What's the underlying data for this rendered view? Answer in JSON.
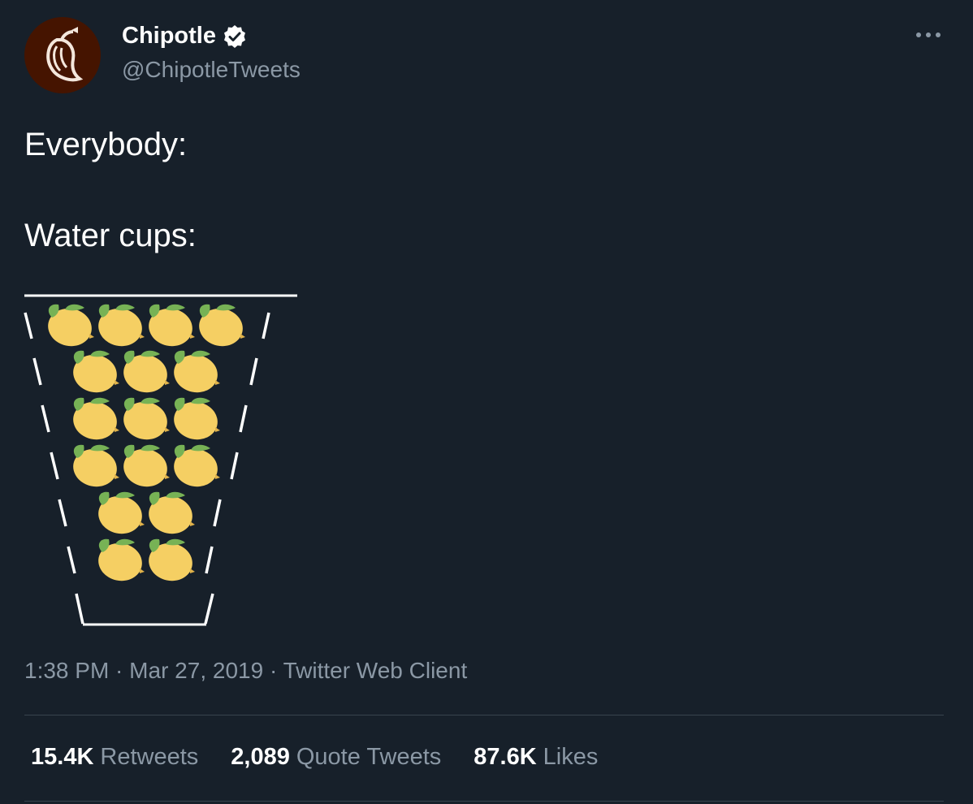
{
  "tweet": {
    "author": {
      "display_name": "Chipotle",
      "handle": "@ChipotleTweets",
      "avatar_icon": "chipotle-pepper-logo",
      "verified": true
    },
    "lines": [
      "Everybody:",
      "Water cups:"
    ],
    "art": {
      "description_icon": "lemon-emoji",
      "rows_lemon_counts": [
        4,
        3,
        3,
        3,
        2,
        2
      ],
      "colors": {
        "lemon": "#f5cf63",
        "leaf": "#77b255"
      }
    },
    "meta": {
      "time": "1:38 PM",
      "date": "Mar 27, 2019",
      "client": "Twitter Web Client",
      "separator": " · "
    },
    "stats": [
      {
        "value": "15.4K",
        "label": "Retweets"
      },
      {
        "value": "2,089",
        "label": "Quote Tweets"
      },
      {
        "value": "87.6K",
        "label": "Likes"
      }
    ]
  },
  "colors": {
    "background": "#17202a",
    "text": "#ffffff",
    "secondary_text": "#8b98a5",
    "divider": "#38444d",
    "avatar_bg": "#451400"
  }
}
